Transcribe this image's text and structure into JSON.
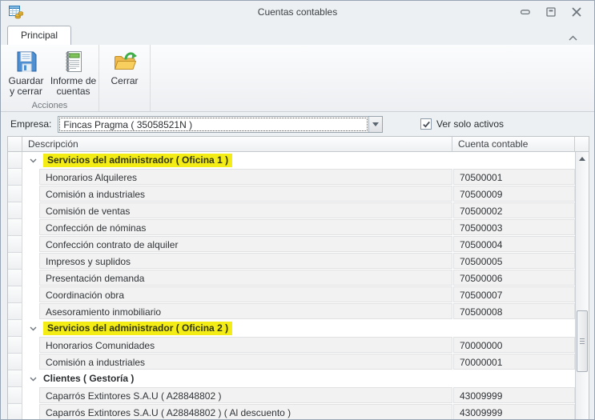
{
  "window": {
    "title": "Cuentas contables"
  },
  "ribbon": {
    "tab_label": "Principal",
    "groups": [
      {
        "caption": "Acciones",
        "buttons": [
          {
            "lines": [
              "Guardar",
              "y cerrar"
            ],
            "icon": "floppy-disk-icon"
          },
          {
            "lines": [
              "Informe de",
              "cuentas"
            ],
            "icon": "report-notebook-icon"
          }
        ]
      },
      {
        "caption": "",
        "buttons": [
          {
            "lines": [
              "Cerrar"
            ],
            "icon": "open-folder-arrow-icon"
          }
        ]
      }
    ]
  },
  "toolbar": {
    "company_label": "Empresa:",
    "company_value": "Fincas Pragma ( 35058521N )",
    "show_active_label": "Ver solo activos",
    "show_active_checked": true
  },
  "grid": {
    "columns": [
      "Descripción",
      "Cuenta contable"
    ],
    "rows": [
      {
        "type": "group",
        "label": "Servicios del administrador ( Oficina 1 )",
        "highlight": true
      },
      {
        "type": "data",
        "desc": "Honorarios Alquileres",
        "account": "70500001"
      },
      {
        "type": "data",
        "desc": "Comisión a industriales",
        "account": "70500009"
      },
      {
        "type": "data",
        "desc": "Comisión de ventas",
        "account": "70500002"
      },
      {
        "type": "data",
        "desc": "Confección de nóminas",
        "account": "70500003"
      },
      {
        "type": "data",
        "desc": "Confección contrato de alquiler",
        "account": "70500004"
      },
      {
        "type": "data",
        "desc": "Impresos y suplidos",
        "account": "70500005"
      },
      {
        "type": "data",
        "desc": "Presentación demanda",
        "account": "70500006"
      },
      {
        "type": "data",
        "desc": "Coordinación obra",
        "account": "70500007"
      },
      {
        "type": "data",
        "desc": "Asesoramiento inmobiliario",
        "account": "70500008"
      },
      {
        "type": "group",
        "label": "Servicios del administrador ( Oficina 2 )",
        "highlight": true
      },
      {
        "type": "data",
        "desc": "Honorarios Comunidades",
        "account": "70000000"
      },
      {
        "type": "data",
        "desc": "Comisión a industriales",
        "account": "70000001"
      },
      {
        "type": "group",
        "label": "Clientes ( Gestoría )",
        "highlight": false
      },
      {
        "type": "data",
        "desc": "Caparrós Extintores S.A.U ( A28848802 )",
        "account": "43009999"
      },
      {
        "type": "data",
        "desc": "Caparrós Extintores S.A.U ( A28848802 ) ( Al descuento )",
        "account": "43009999"
      }
    ]
  },
  "icons": {
    "app": "table-coins-icon",
    "save": "floppy-disk-icon",
    "report": "report-notebook-icon",
    "close_window_group": "open-folder-arrow-icon",
    "ribbon_collapse": "chevron-up-icon",
    "group_expand": "chevron-down-icon",
    "combo_dropdown": "chevron-down-icon",
    "checkbox": "checkmark-icon",
    "scroll_up": "triangle-up-icon",
    "window": [
      "minimize-icon",
      "maximize-icon",
      "close-icon"
    ]
  },
  "colors": {
    "group_highlight": "#f3ed15",
    "ribbon_background": "#f0f2f4",
    "row_background": "#f2f2f2"
  }
}
